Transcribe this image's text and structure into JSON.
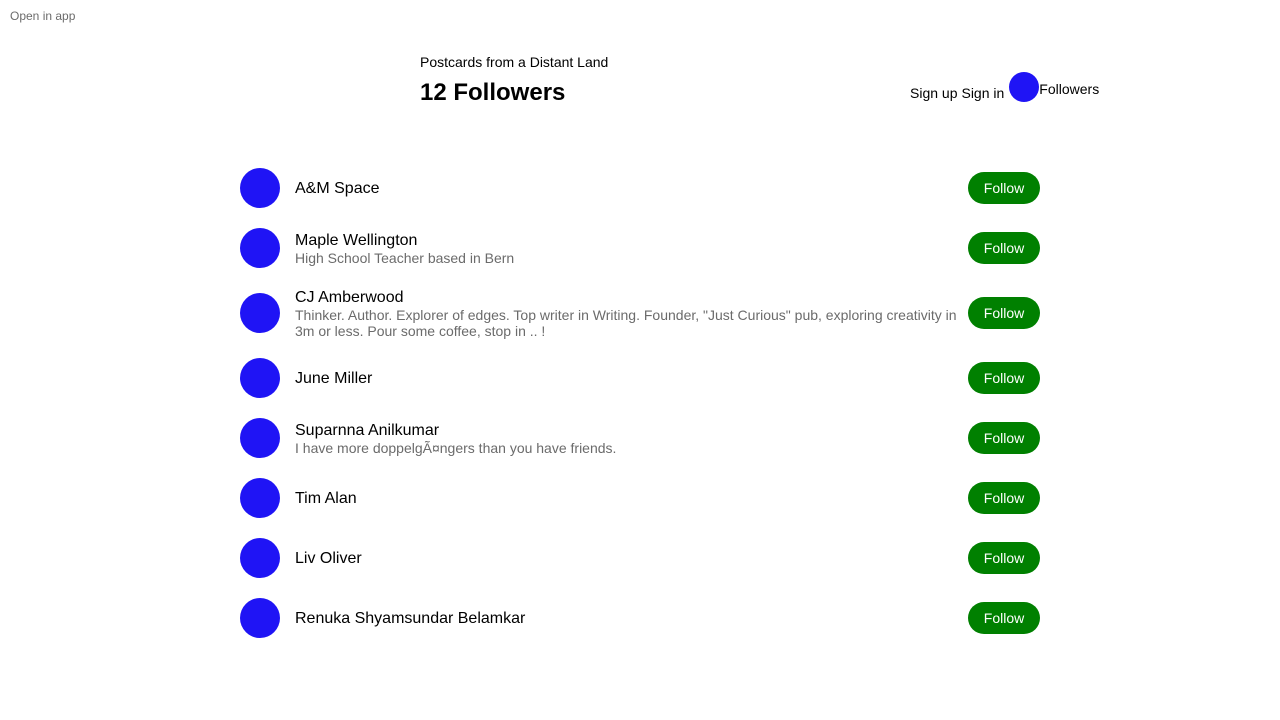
{
  "header": {
    "open_in_app": "Open in app",
    "publication_name": "Postcards from a Distant Land",
    "title": "12 Followers",
    "sign_up": "Sign up",
    "sign_in": "Sign in",
    "followers_link": "Followers"
  },
  "colors": {
    "avatar": "#1f14f5",
    "follow_button": "#008000",
    "secondary_text": "#6b6b6b"
  },
  "followers": [
    {
      "name": "A&M Space",
      "bio": "",
      "button": "Follow"
    },
    {
      "name": "Maple Wellington",
      "bio": "High School Teacher based in Bern",
      "button": "Follow"
    },
    {
      "name": "CJ Amberwood",
      "bio": "Thinker. Author. Explorer of edges. Top writer in Writing. Founder, \"Just Curious\" pub, exploring creativity in 3m or less. Pour some coffee, stop in .. !",
      "button": "Follow"
    },
    {
      "name": "June Miller",
      "bio": "",
      "button": "Follow"
    },
    {
      "name": "Suparnna Anilkumar",
      "bio": "I have more doppelgÃ¤ngers than you have friends.",
      "button": "Follow"
    },
    {
      "name": "Tim Alan",
      "bio": "",
      "button": "Follow"
    },
    {
      "name": "Liv Oliver",
      "bio": "",
      "button": "Follow"
    },
    {
      "name": "Renuka Shyamsundar Belamkar",
      "bio": "",
      "button": "Follow"
    }
  ]
}
